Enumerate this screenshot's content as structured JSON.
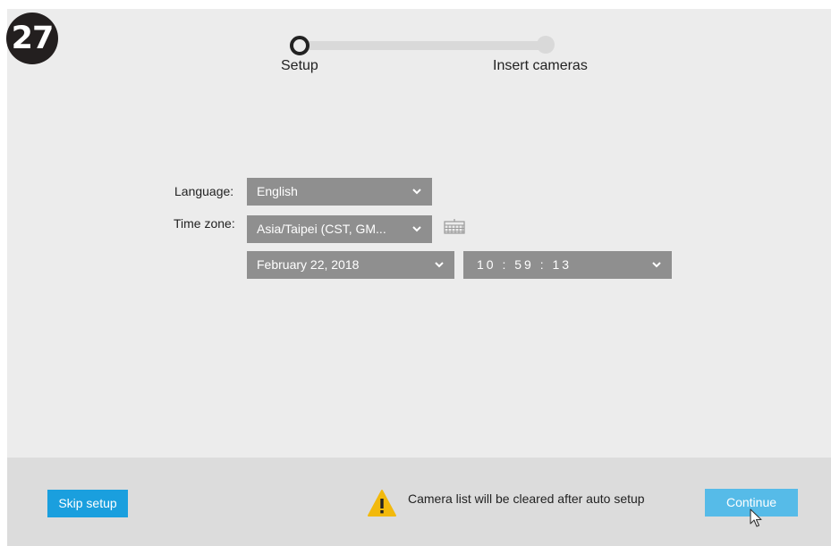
{
  "step_badge": "27",
  "stepper": {
    "steps": [
      {
        "label": "Setup",
        "state": "active"
      },
      {
        "label": "Insert cameras",
        "state": "inactive"
      }
    ]
  },
  "form": {
    "language": {
      "label": "Language:",
      "value": "English"
    },
    "time_zone": {
      "label": "Time zone:",
      "value": "Asia/Taipei (CST, GM..."
    },
    "date": {
      "value": "February 22, 2018"
    },
    "time": {
      "value": "10 : 59 : 13"
    },
    "keyboard_icon": "keyboard-icon"
  },
  "footer": {
    "skip_label": "Skip setup",
    "warning_text": "Camera list will be cleared after auto setup",
    "continue_label": "Continue"
  },
  "colors": {
    "background": "#ececec",
    "footer": "#dcdcdc",
    "select": "#8f8f8f",
    "accent": "#1a9fde",
    "accent_light": "#56bbe8",
    "warning": "#f2b90c"
  }
}
